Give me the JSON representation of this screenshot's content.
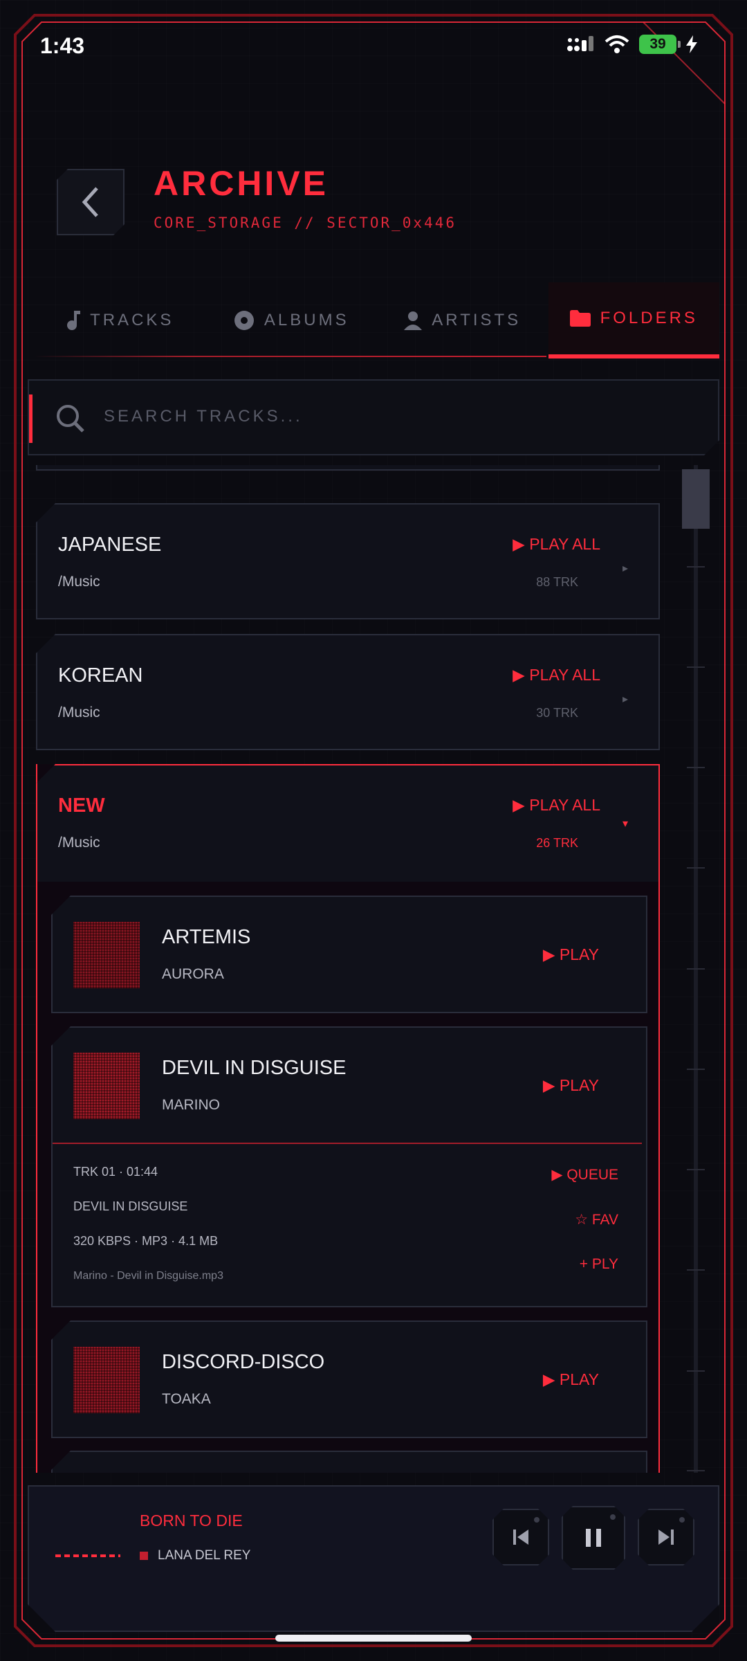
{
  "status_bar": {
    "time": "1:43",
    "battery": "39"
  },
  "header": {
    "title": "ARCHIVE",
    "subtitle": "CORE_STORAGE // SECTOR_0x446"
  },
  "tabs": [
    {
      "label": "TRACKS",
      "icon": "music-note-icon",
      "active": false
    },
    {
      "label": "ALBUMS",
      "icon": "disc-icon",
      "active": false
    },
    {
      "label": "ARTISTS",
      "icon": "person-icon",
      "active": false
    },
    {
      "label": "FOLDERS",
      "icon": "folder-icon",
      "active": true
    }
  ],
  "search": {
    "placeholder": "SEARCH TRACKS..."
  },
  "folders": [
    {
      "name": "JAPANESE",
      "path": "/Music",
      "action": "▶ PLAY ALL",
      "count": "88 TRK",
      "chevron": "▸"
    },
    {
      "name": "KOREAN",
      "path": "/Music",
      "action": "▶ PLAY ALL",
      "count": "30 TRK",
      "chevron": "▸"
    },
    {
      "name": "NEW",
      "path": "/Music",
      "action": "▶ PLAY ALL",
      "count": "26 TRK",
      "chevron": "▾"
    }
  ],
  "tracks": [
    {
      "title": "ARTEMIS",
      "artist": "AURORA",
      "action": "▶ PLAY"
    },
    {
      "title": "DEVIL IN DISGUISE",
      "artist": "MARINO",
      "action": "▶ PLAY"
    },
    {
      "title": "DISCORD-DISCO",
      "artist": "TOAKA",
      "action": "▶ PLAY"
    }
  ],
  "track_detail": {
    "meta": "TRK 01  ·  01:44",
    "title": "DEVIL IN DISGUISE",
    "format": "320 KBPS · MP3 · 4.1 MB",
    "filename": "Marino - Devil in Disguise.mp3",
    "queue": "▶ QUEUE",
    "fav": "☆ FAV",
    "ply": "+ PLY"
  },
  "player": {
    "title": "BORN TO DIE",
    "artist": "LANA DEL REY"
  },
  "colors": {
    "accent": "#ff2d3d",
    "background": "#0b0b11",
    "panel": "#10111a"
  }
}
